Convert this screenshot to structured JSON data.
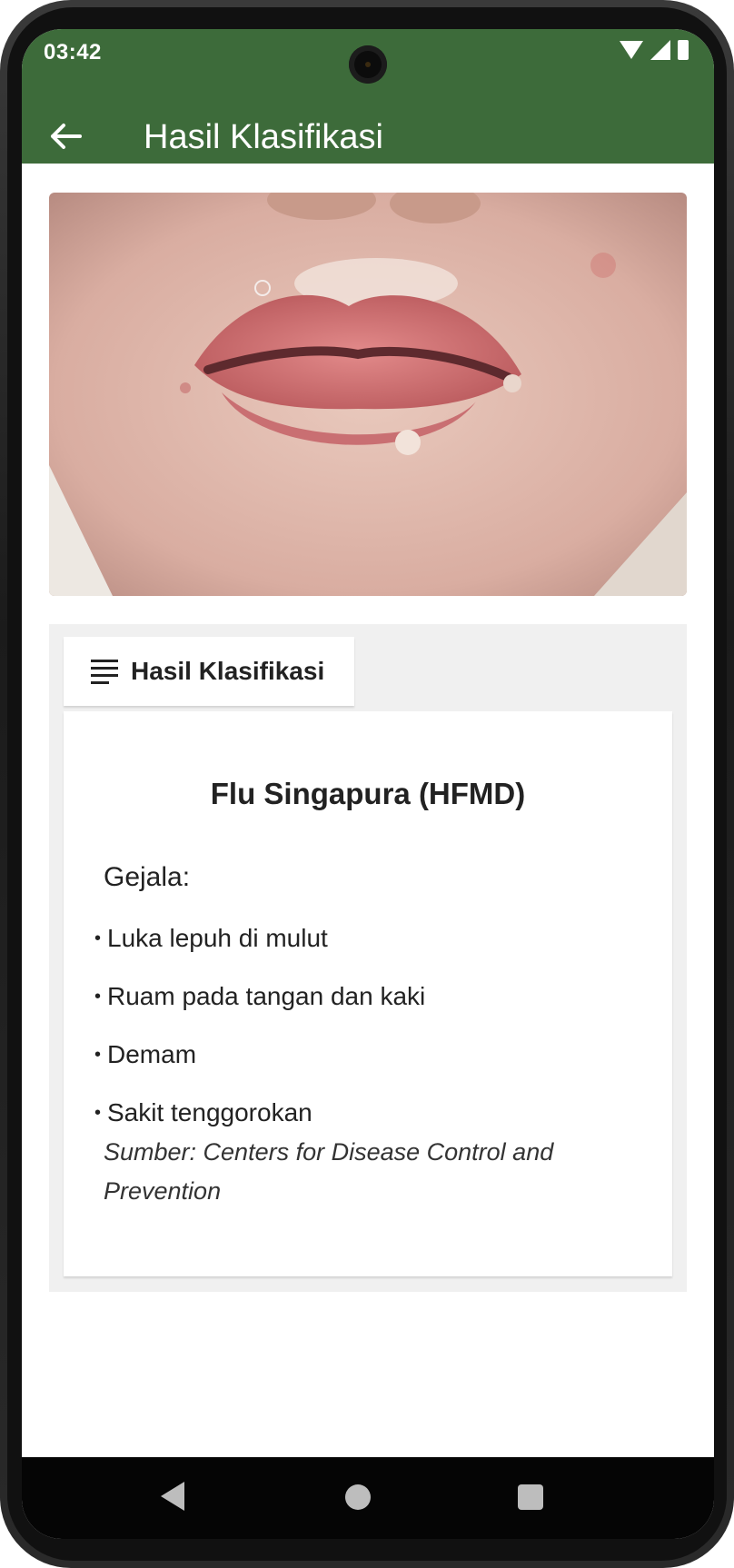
{
  "status_bar": {
    "time": "03:42"
  },
  "app_bar": {
    "title": "Hasil Klasifikasi",
    "back_icon": "arrow-back-icon"
  },
  "result_card": {
    "tab_label": "Hasil Klasifikasi",
    "tab_icon": "list-icon",
    "disease_name": "Flu Singapura (HFMD)",
    "symptoms_heading": "Gejala:",
    "symptoms": [
      "Luka lepuh di mulut",
      "Ruam pada tangan dan kaki",
      "Demam",
      "Sakit tenggorokan"
    ],
    "bullet": "•",
    "source": "Sumber: Centers for Disease Control and Prevention"
  },
  "colors": {
    "app_bar": "#3d6b3a",
    "card_background": "#f0f0f0",
    "nav_bar": "#050505"
  }
}
